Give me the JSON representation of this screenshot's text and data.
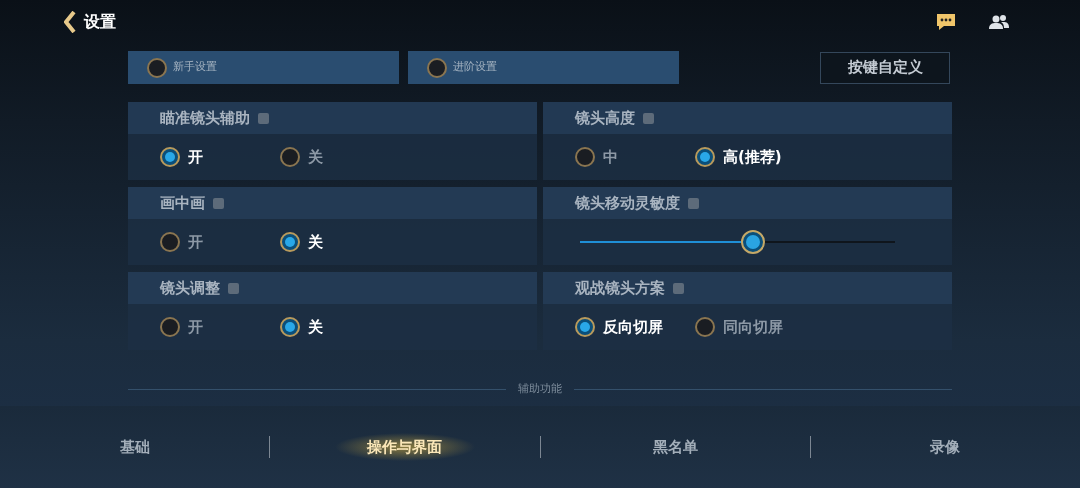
{
  "header": {
    "title": "设置"
  },
  "presets": [
    {
      "label": "新手设置",
      "selected": false
    },
    {
      "label": "进阶设置",
      "selected": false
    }
  ],
  "custom_keys_button": "按键自定义",
  "settings": [
    {
      "kind": "radio",
      "title": "瞄准镜头辅助",
      "options": [
        {
          "label": "开",
          "selected": true
        },
        {
          "label": "关",
          "selected": false
        }
      ]
    },
    {
      "kind": "radio",
      "title": "镜头高度",
      "options": [
        {
          "label": "中",
          "selected": false
        },
        {
          "label": "高(推荐)",
          "selected": true
        }
      ]
    },
    {
      "kind": "radio",
      "title": "画中画",
      "options": [
        {
          "label": "开",
          "selected": false
        },
        {
          "label": "关",
          "selected": true
        }
      ]
    },
    {
      "kind": "slider",
      "title": "镜头移动灵敏度",
      "level": 0.55
    },
    {
      "kind": "radio",
      "title": "镜头调整",
      "options": [
        {
          "label": "开",
          "selected": false
        },
        {
          "label": "关",
          "selected": true
        }
      ]
    },
    {
      "kind": "radio",
      "title": "观战镜头方案",
      "options": [
        {
          "label": "反向切屏",
          "selected": true
        },
        {
          "label": "同向切屏",
          "selected": false
        }
      ]
    }
  ],
  "section_label": "辅助功能",
  "tabs": [
    {
      "label": "基础",
      "selected": false
    },
    {
      "label": "操作与界面",
      "selected": true
    },
    {
      "label": "黑名单",
      "selected": false
    },
    {
      "label": "录像",
      "selected": false
    }
  ]
}
